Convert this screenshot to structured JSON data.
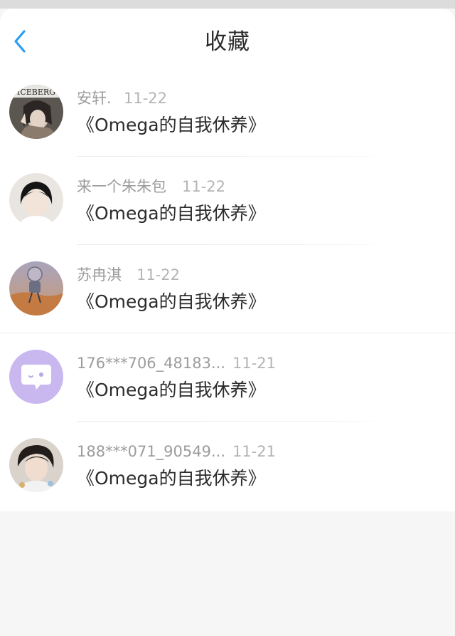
{
  "header": {
    "title": "收藏",
    "back_icon": "chevron-left-icon",
    "accent_color": "#2a9ef4"
  },
  "favorites": [
    {
      "user": "安轩.",
      "date": "11-22",
      "title": "《Omega的自我休养》",
      "avatar_text": "ICEBERG"
    },
    {
      "user": "来一个朱朱包",
      "date": "11-22",
      "title": "《Omega的自我休养》"
    },
    {
      "user": "苏冉淇",
      "date": "11-22",
      "title": "《Omega的自我休养》"
    },
    {
      "user": "176***706_48183...",
      "date": "11-21",
      "title": "《Omega的自我休养》",
      "avatar_icon": "chat-bubble-icon",
      "avatar_color": "#c9b8f0"
    },
    {
      "user": "188***071_90549...",
      "date": "11-21",
      "title": "《Omega的自我休养》"
    }
  ]
}
